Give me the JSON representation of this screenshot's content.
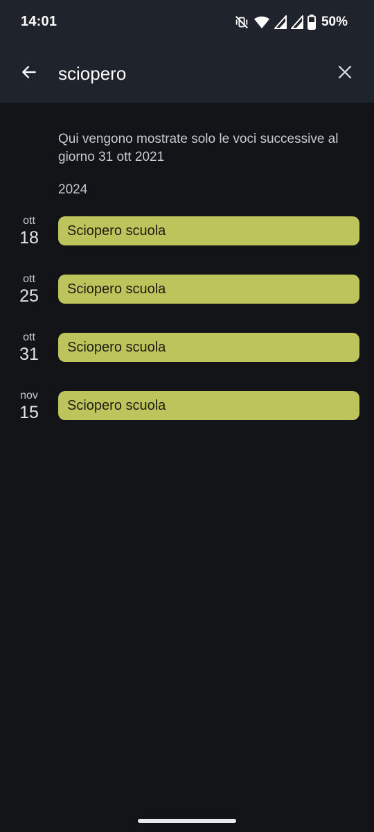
{
  "status_bar": {
    "time": "14:01",
    "battery_percent": "50%",
    "icons": [
      "vibrate-off-icon",
      "wifi-icon",
      "signal-icon",
      "signal-icon",
      "battery-icon"
    ]
  },
  "search": {
    "query": "sciopero",
    "back_icon": "arrow-back-icon",
    "clear_icon": "close-icon"
  },
  "notice": "Qui vengono mostrate solo le voci successive al giorno 31 ott 2021",
  "year": "2024",
  "events": [
    {
      "month": "ott",
      "day": "18",
      "title": "Sciopero scuola"
    },
    {
      "month": "ott",
      "day": "25",
      "title": "Sciopero scuola"
    },
    {
      "month": "ott",
      "day": "31",
      "title": "Sciopero scuola"
    },
    {
      "month": "nov",
      "day": "15",
      "title": "Sciopero scuola"
    }
  ],
  "colors": {
    "background": "#131418",
    "header": "#1f232b",
    "event_chip": "#bec45c",
    "event_text": "#1c1d12"
  }
}
